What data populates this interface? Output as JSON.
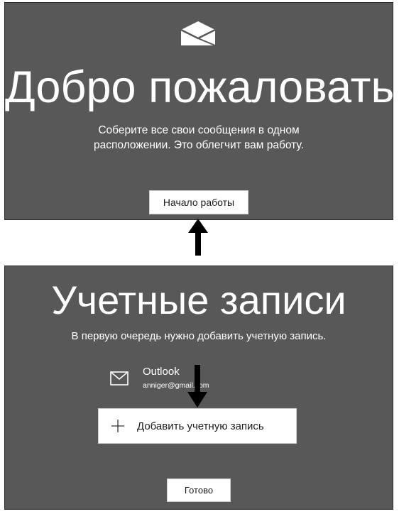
{
  "welcome": {
    "title": "Добро пожаловать",
    "description": "Соберите все свои сообщения в одном расположении. Это облегчит вам работу.",
    "start_button": "Начало работы",
    "logo_icon": "mail-app-icon"
  },
  "accounts": {
    "title": "Учетные записи",
    "description": "В первую очередь нужно добавить учетную запись.",
    "account": {
      "name": "Outlook",
      "email": "anniger@gmail.com",
      "icon": "envelope-icon"
    },
    "add_button": "Добавить учетную запись",
    "add_icon": "plus-icon",
    "done_button": "Готово"
  },
  "colors": {
    "panel_background": "#585858",
    "button_background": "#ffffff",
    "arrow": "#000000"
  }
}
